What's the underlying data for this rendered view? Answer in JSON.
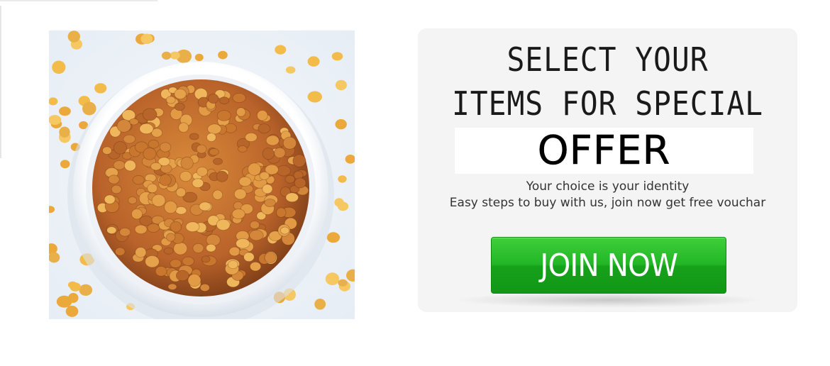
{
  "hero": {
    "image_icon": "roasted-chana-bowl-photo"
  },
  "offer": {
    "headline_line1": "SELECT YOUR",
    "headline_line2": "ITEMS FOR SPECIAL",
    "offer_word": "OFFER",
    "tagline_line1": "Your choice is your identity",
    "tagline_line2": "Easy steps to buy with us, join now get free vouchar",
    "join_label": "JOIN NOW"
  },
  "colors": {
    "card_background": "#f4f4f4",
    "button_green": "#22b626",
    "button_text": "#ffffff",
    "headline_text": "#1a1a1a"
  }
}
